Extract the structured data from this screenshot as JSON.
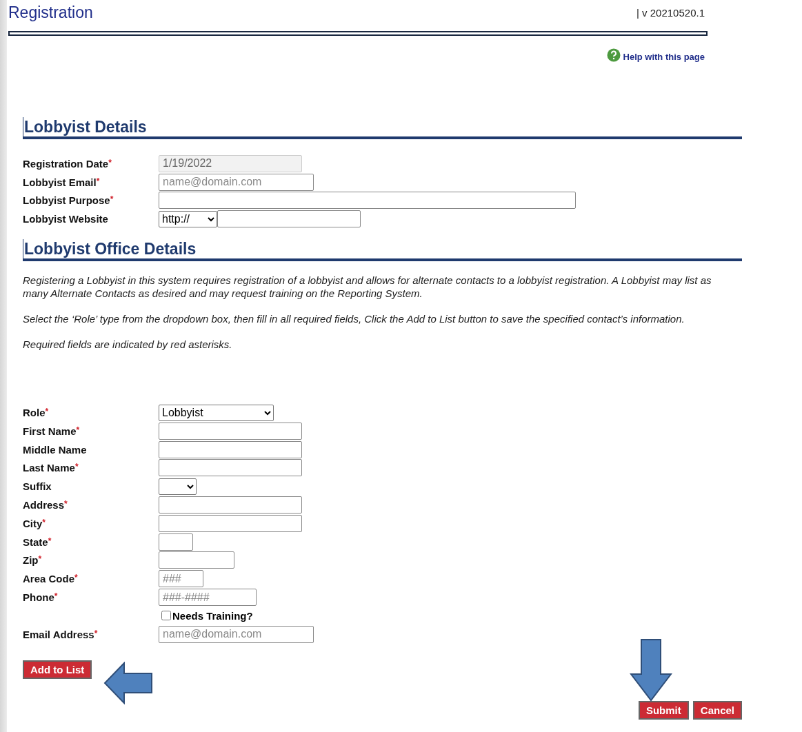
{
  "header": {
    "title": "Registration",
    "version": "| v 20210520.1",
    "help_link": "Help with this page"
  },
  "sections": [
    {
      "title": "Lobbyist Details",
      "fields": [
        {
          "kind": "text",
          "label": "Registration Date",
          "asterisk": "*",
          "value": "1/19/2022",
          "disabled": true
        },
        {
          "kind": "text",
          "label": "Lobbyist Email",
          "asterisk": "*",
          "placeholder": "name@domain.com"
        },
        {
          "kind": "text",
          "label": "Lobbyist Purpose",
          "asterisk": "*"
        },
        {
          "kind": "url",
          "label": "Lobbyist Website",
          "value": "http://"
        }
      ]
    },
    {
      "title": "Lobbyist Office Details",
      "paragraphs": [
        "Registering a Lobbyist in this system requires registration of a lobbyist and allows for alternate contacts to a lobbyist registration. A Lobbyist may list as many Alternate Contacts as desired and may request training on the Reporting System.",
        "Select the ‘Role’ type from the dropdown box, then fill in all required fields, Click the Add to List button to save the specified contact’s information.",
        "Required fields are indicated by red asterisks."
      ],
      "fields": [
        {
          "kind": "select",
          "label": "Role",
          "asterisk": "*",
          "value": "Lobbyist"
        },
        {
          "kind": "text",
          "label": "First Name",
          "asterisk": "*"
        },
        {
          "kind": "text",
          "label": "Middle Name"
        },
        {
          "kind": "text",
          "label": "Last Name",
          "asterisk": "*"
        },
        {
          "kind": "select",
          "label": "Suffix"
        },
        {
          "kind": "text",
          "label": "Address",
          "asterisk": "*"
        },
        {
          "kind": "text",
          "label": "City",
          "asterisk": "*"
        },
        {
          "kind": "text",
          "label": "State",
          "asterisk": "*"
        },
        {
          "kind": "text",
          "label": "Zip",
          "asterisk": "*"
        },
        {
          "kind": "text",
          "label": "Area Code",
          "asterisk": "*",
          "placeholder": "###"
        },
        {
          "kind": "text",
          "label": "Phone",
          "asterisk": "*",
          "placeholder": "###-####"
        },
        {
          "kind": "checkbox",
          "label": "Needs Training?",
          "checked": false
        },
        {
          "kind": "text",
          "label": "Email Address",
          "asterisk": "*",
          "placeholder": "name@domain.com"
        }
      ]
    }
  ],
  "add_button": "Add to List",
  "buttons": [
    "Submit",
    "Cancel"
  ]
}
